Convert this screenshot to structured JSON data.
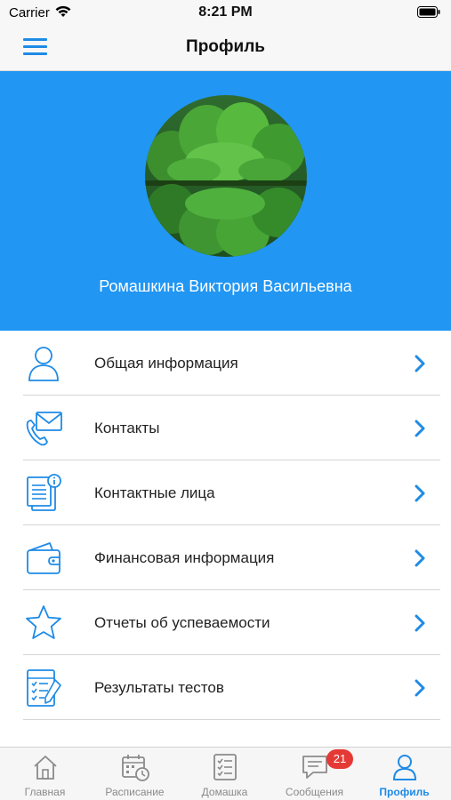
{
  "status_bar": {
    "carrier": "Carrier",
    "time": "8:21 PM"
  },
  "nav": {
    "title": "Профиль",
    "menu_icon": "hamburger-menu-icon"
  },
  "profile": {
    "name": "Ромашкина Виктория Васильевна",
    "avatar": "forest-lake-photo"
  },
  "menu_items": [
    {
      "label": "Общая информация",
      "icon": "person-icon"
    },
    {
      "label": "Контакты",
      "icon": "phone-envelope-icon"
    },
    {
      "label": "Контактные лица",
      "icon": "contact-document-icon"
    },
    {
      "label": "Финансовая информация",
      "icon": "wallet-icon"
    },
    {
      "label": "Отчеты об успеваемости",
      "icon": "star-icon"
    },
    {
      "label": "Результаты тестов",
      "icon": "test-checklist-icon"
    }
  ],
  "tabs": [
    {
      "label": "Главная",
      "icon": "home-icon"
    },
    {
      "label": "Расписание",
      "icon": "calendar-clock-icon"
    },
    {
      "label": "Домашка",
      "icon": "checklist-icon"
    },
    {
      "label": "Сообщения",
      "icon": "chat-bubble-icon",
      "badge": "21"
    },
    {
      "label": "Профиль",
      "icon": "profile-icon",
      "active": true
    }
  ],
  "colors": {
    "accent": "#2196F3",
    "badge": "#E53935",
    "inactive": "#8A8A8A"
  }
}
